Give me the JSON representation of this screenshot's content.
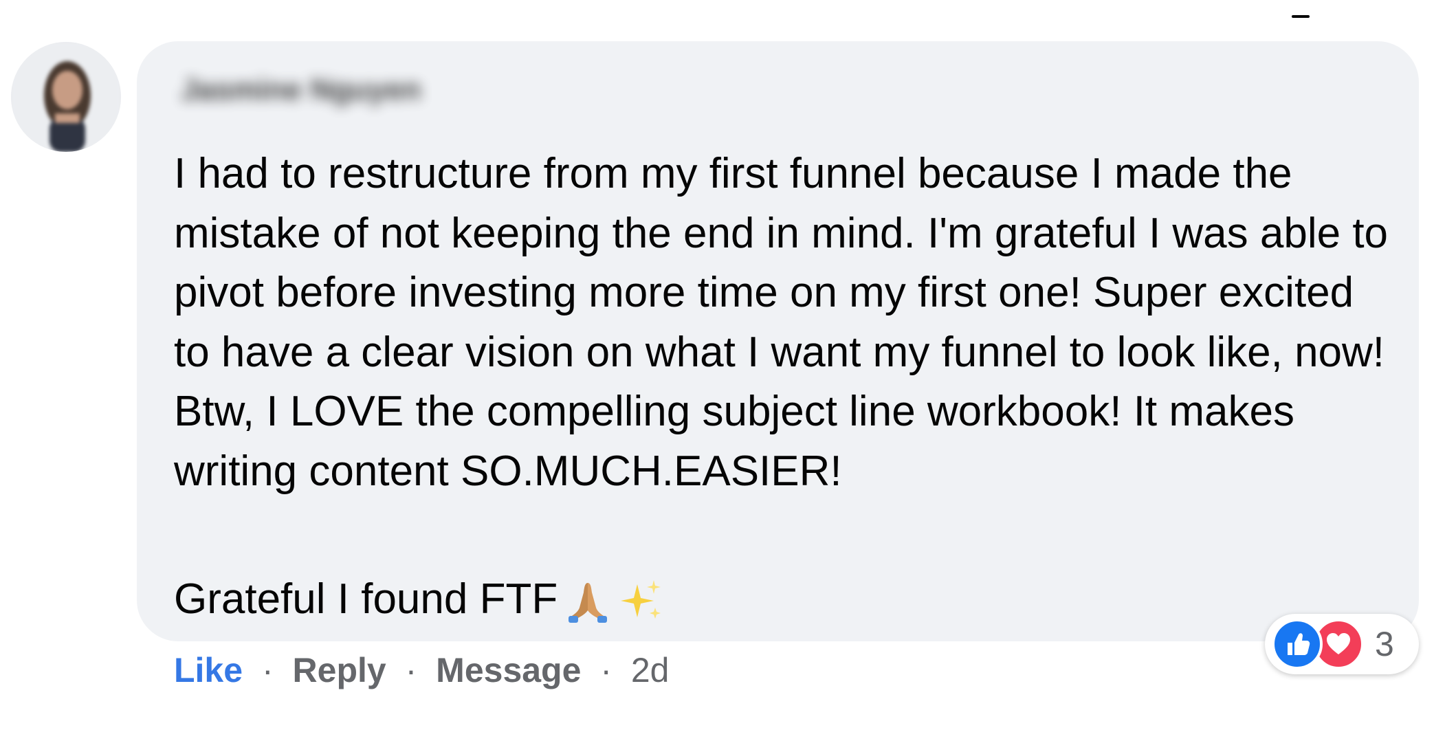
{
  "comment": {
    "author": "Jasmine Nguyen",
    "text": "I had to restructure from my first funnel because I made the mistake of not keeping the end in mind. I'm grateful I was able to pivot before investing more time on my first one! Super excited to have a clear vision on what I want my funnel to look like, now! Btw, I LOVE the compelling subject line workbook! It makes writing content SO.MUCH.EASIER!",
    "text2": "Grateful I found FTF",
    "emojis": [
      "folded-hands",
      "sparkles"
    ]
  },
  "actions": {
    "like": "Like",
    "reply": "Reply",
    "message": "Message",
    "separator": "·",
    "timestamp": "2d"
  },
  "reactions": {
    "types": [
      "like",
      "love"
    ],
    "count": "3"
  },
  "colors": {
    "bubble": "#f0f2f5",
    "like_blue": "#3578e5",
    "love_red": "#f33e58",
    "secondary_text": "#65676b"
  }
}
